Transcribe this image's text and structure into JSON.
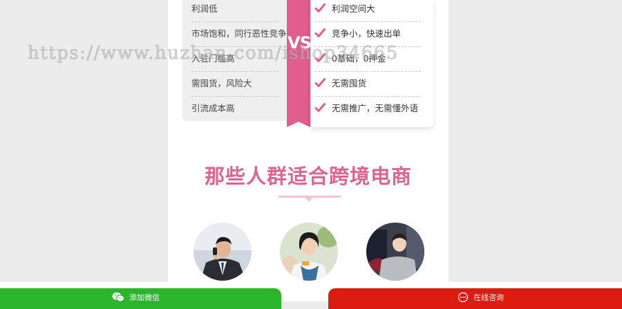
{
  "comparison": {
    "vs_label": "VS",
    "left_items": [
      "利润低",
      "市场饱和，同行恶性竞争",
      "入驻门槛高",
      "需囤货，风险大",
      "引流成本高"
    ],
    "right_items": [
      "利润空间大",
      "竞争小，快速出单",
      "0基础，0押金",
      "无需囤货",
      "无需推广，无需懂外语"
    ],
    "accent_color": "#e05d8d"
  },
  "section": {
    "title": "那些人群适合跨境电商"
  },
  "avatars": [
    {
      "icon": "businessman-avatar"
    },
    {
      "icon": "young-woman-avatar"
    },
    {
      "icon": "young-man-avatar"
    }
  ],
  "watermark": "https://www.huzhan.com/ishop34665",
  "bottom_bar": {
    "wechat_label": "添加微信",
    "consult_label": "在线咨询",
    "wechat_color": "#2ab52a",
    "consult_color": "#dc1c10"
  }
}
